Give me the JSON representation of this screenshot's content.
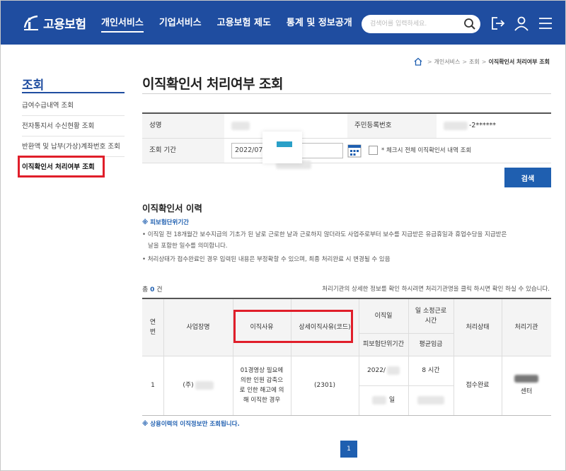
{
  "header": {
    "logo_text": "고용보험",
    "nav": [
      "개인서비스",
      "기업서비스",
      "고용보험 제도",
      "통계 및 정보공개"
    ],
    "search_placeholder": "검색어를 입력하세요."
  },
  "breadcrumb": [
    "개인서비스",
    "조회",
    "이직확인서 처리여부 조회"
  ],
  "sidebar": {
    "title": "조회",
    "items": [
      "급여수급내역 조회",
      "전자통지서 수신현황 조회",
      "반환액 및 납부(가상)계좌번호 조회",
      "이직확인서 처리여부 조회"
    ]
  },
  "page": {
    "title": "이직확인서 처리여부 조회"
  },
  "form": {
    "name_label": "성명",
    "rrn_label": "주민등록번호",
    "rrn_value": "-2******",
    "period_label": "조회 기간",
    "date_value": "2022/07/",
    "check_label": "* 체크시 전체 이직확인서 내역 조회",
    "search_button": "검색"
  },
  "history": {
    "title": "이직확인서 이력",
    "note_head": "※ 피보험단위기간",
    "note1": "• 이직일 전 18개월간 보수지급의 기초가 된 날로 근로한 날과 근로하지 않더라도 사업주로부터 보수를 지급받은 유급휴일과 휴업수당을 지급받은",
    "note1b": "날을 포함한 일수를 의미합니다.",
    "note2": "• 처리상태가 접수완료인 경우 입력된 내용은 부정확할 수 있으며, 최종 처리완료 시 변경될 수 있음",
    "count_prefix": "총",
    "count_value": "0",
    "count_suffix": "건",
    "count_info": "처리기관의 상세한 정보를 확인 하시려면 처리기관명을 클릭 하시면 확인 하실 수 있습니다."
  },
  "table": {
    "headers": {
      "no": "연\n번",
      "company": "사업장명",
      "reason": "이직사유",
      "detail": "상세이직사유(코드)",
      "date": "이직일",
      "period": "피보험단위기간",
      "hours": "일 소정근로\n시간",
      "wage": "평균임금",
      "status": "처리상태",
      "agency": "처리기관"
    },
    "row": {
      "no": "1",
      "company": "(주)",
      "reason": "01경영상 필요에\n의한 인원 감축으\n로 인한 해고에 의\n해 이직한 경우",
      "code": "(2301)",
      "date": "2022/",
      "period": "일",
      "hours": "8 시간",
      "status": "접수완료",
      "agency": "센터"
    },
    "footer": "※ 상용이력의 이직정보만 조회됩니다."
  },
  "pagination": {
    "current": "1"
  }
}
